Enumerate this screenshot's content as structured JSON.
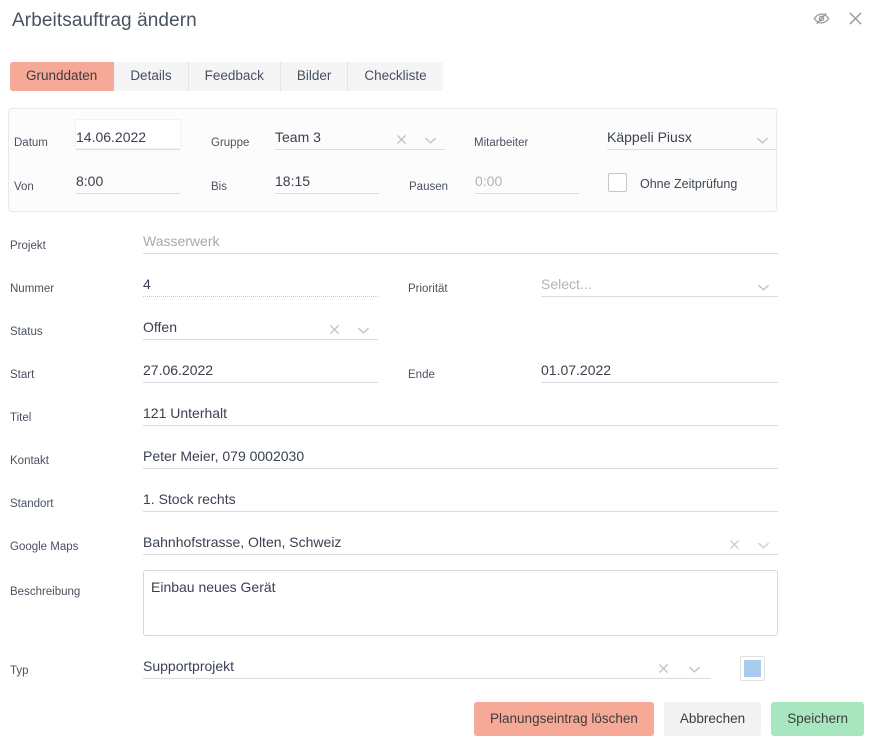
{
  "header": {
    "title": "Arbeitsauftrag ändern",
    "icons": [
      {
        "name": "eye-slash-icon",
        "label": "Sichtbarkeit umschalten"
      },
      {
        "name": "close-icon",
        "label": "Schliessen"
      }
    ]
  },
  "tabs": [
    {
      "label": "Grunddaten",
      "active": true
    },
    {
      "label": "Details",
      "active": false
    },
    {
      "label": "Feedback",
      "active": false
    },
    {
      "label": "Bilder",
      "active": false
    },
    {
      "label": "Checkliste",
      "active": false
    }
  ],
  "top_panel": {
    "datum": {
      "label": "Datum",
      "value": "14.06.2022"
    },
    "gruppe": {
      "label": "Gruppe",
      "value": "Team 3"
    },
    "mitarbeiter": {
      "label": "Mitarbeiter",
      "value": "Käppeli Piusx"
    },
    "von": {
      "label": "Von",
      "value": "8:00"
    },
    "bis": {
      "label": "Bis",
      "value": "18:15"
    },
    "pausen": {
      "label": "Pausen",
      "value": "",
      "placeholder": "0:00"
    },
    "ohne_zeitpruefung": {
      "label": "Ohne Zeitprüfung",
      "checked": false
    }
  },
  "form": {
    "projekt": {
      "label": "Projekt",
      "value": "Wasserwerk"
    },
    "nummer": {
      "label": "Nummer",
      "value": "4"
    },
    "prioritaet": {
      "label": "Priorität",
      "value": "",
      "placeholder": "Select..."
    },
    "status": {
      "label": "Status",
      "value": "Offen"
    },
    "start": {
      "label": "Start",
      "value": "27.06.2022"
    },
    "ende": {
      "label": "Ende",
      "value": "01.07.2022"
    },
    "titel": {
      "label": "Titel",
      "value": "121 Unterhalt"
    },
    "kontakt": {
      "label": "Kontakt",
      "value": "Peter Meier, 079 0002030"
    },
    "standort": {
      "label": "Standort",
      "value": "1. Stock rechts"
    },
    "google_maps": {
      "label": "Google Maps",
      "value": "Bahnhofstrasse, Olten, Schweiz"
    },
    "beschreibung": {
      "label": "Beschreibung",
      "value": "Einbau neues Gerät"
    },
    "typ": {
      "label": "Typ",
      "value": "Supportprojekt",
      "color": "#a9cbec"
    }
  },
  "footer": {
    "delete_label": "Planungseintrag löschen",
    "cancel_label": "Abbrechen",
    "save_label": "Speichern"
  },
  "colors": {
    "accent_red": "#f6a996",
    "accent_green": "#a8e6bf",
    "neutral": "#f2f2f2",
    "typ_swatch": "#a9cbec"
  }
}
